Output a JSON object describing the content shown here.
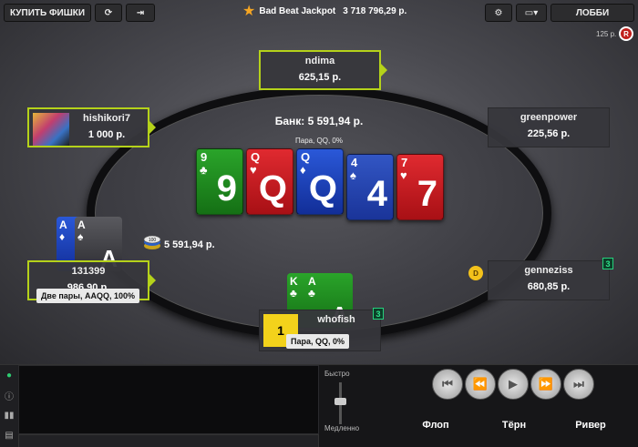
{
  "topbar": {
    "buy_chips": "КУПИТЬ ФИШКИ",
    "jackpot_label": "Bad Beat Jackpot",
    "jackpot_value": "3 718 796,29 р.",
    "lobby": "ЛОББИ",
    "stake": "125 р.",
    "rating_badge": "R"
  },
  "table": {
    "pot": "Банк: 5 591,94 р.",
    "board_hand": "Пара, QQ, 0%",
    "board_cards": [
      {
        "rank": "9",
        "suit": "♣",
        "color": "green"
      },
      {
        "rank": "Q",
        "suit": "♥",
        "color": "red"
      },
      {
        "rank": "Q",
        "suit": "♦",
        "color": "blue"
      },
      {
        "rank": "4",
        "suit": "♠",
        "color": "blue"
      },
      {
        "rank": "7",
        "suit": "♥",
        "color": "red"
      }
    ],
    "bet_chip": "100",
    "bet_amount": "5 591,94 р.",
    "dealer": "D"
  },
  "seats": {
    "top": {
      "name": "ndima",
      "stack": "625,15 р."
    },
    "left_top": {
      "name": "hishikori7",
      "stack": "1 000 р."
    },
    "right_top": {
      "name": "greenpower",
      "stack": "225,56 р."
    },
    "left_bottom": {
      "name": "131399",
      "stack": "986,90 р.",
      "hand": "Две пары, AAQQ, 100%",
      "cards": [
        {
          "rank": "A",
          "suit": "♦"
        },
        {
          "rank": "A",
          "suit": "♠"
        }
      ]
    },
    "right_bottom": {
      "name": "genneziss",
      "stack": "680,85 р.",
      "counter": "3"
    },
    "bottom": {
      "name": "whofish",
      "hand": "Пара, QQ, 0%",
      "counter": "3",
      "avatar_text": "1",
      "cards": [
        {
          "rank": "K",
          "suit": "♣"
        },
        {
          "rank": "A",
          "suit": "♣"
        }
      ]
    }
  },
  "controls": {
    "speed_fast": "Быстро",
    "speed_slow": "Медленно",
    "streets": [
      "Флоп",
      "Тёрн",
      "Ривер"
    ]
  }
}
